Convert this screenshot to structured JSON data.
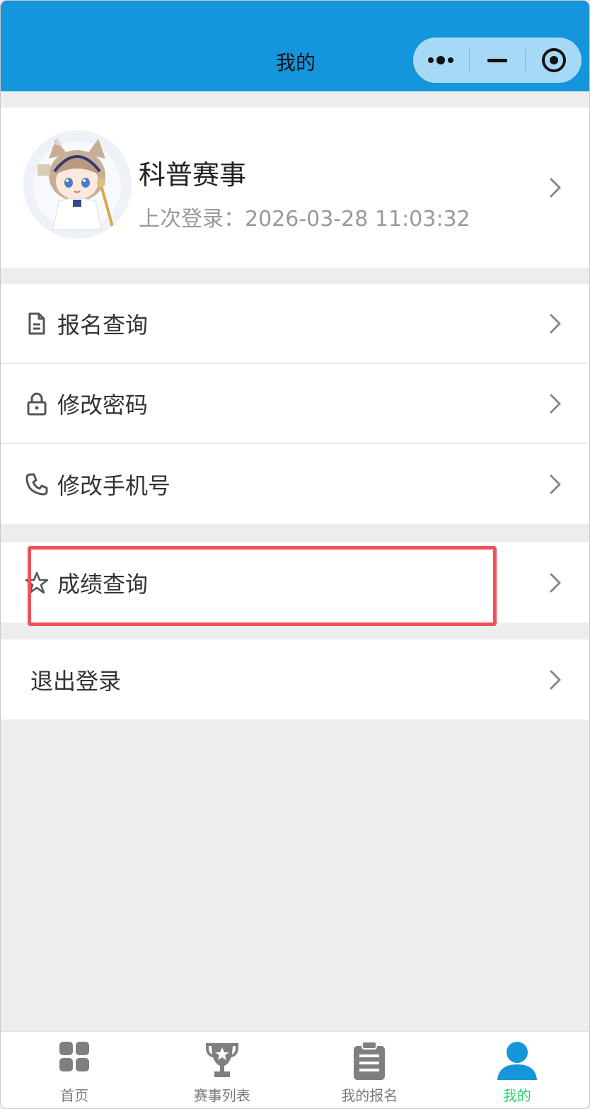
{
  "header": {
    "title": "我的"
  },
  "colors": {
    "header_bg": "#1595db",
    "active_tab": "#2bd56c",
    "highlight": "#ef5158"
  },
  "profile": {
    "name": "科普赛事",
    "last_login": "上次登录：2026-03-28 11:03:32"
  },
  "menu": {
    "registration_query": "报名查询",
    "change_password": "修改密码",
    "change_phone": "修改手机号",
    "score_query": "成绩查询",
    "logout": "退出登录"
  },
  "tabbar": {
    "items": [
      {
        "label": "首页",
        "icon": "grid-icon"
      },
      {
        "label": "赛事列表",
        "icon": "trophy-icon"
      },
      {
        "label": "我的报名",
        "icon": "clipboard-icon"
      },
      {
        "label": "我的",
        "icon": "user-icon",
        "active": true
      }
    ]
  }
}
